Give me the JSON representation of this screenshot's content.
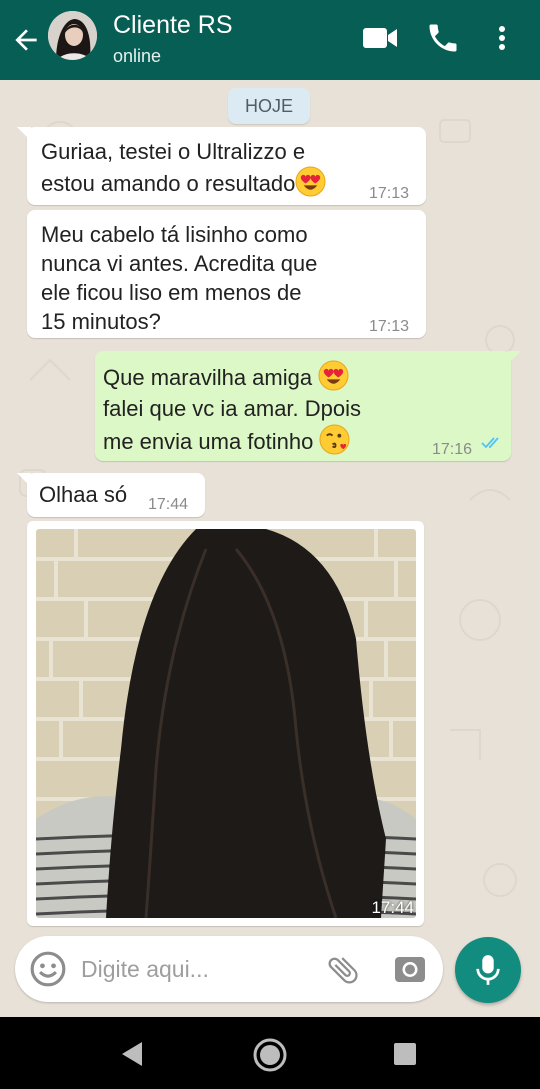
{
  "header": {
    "contact_name": "Cliente RS",
    "status": "online",
    "colors": {
      "bar": "#075e54",
      "accent": "#128c7e"
    },
    "icons": [
      "back-arrow-icon",
      "video-call-icon",
      "phone-icon",
      "more-vert-icon"
    ]
  },
  "chat": {
    "date_label": "HOJE",
    "messages": [
      {
        "direction": "in",
        "lines": [
          "Guriaa, testei o Ultralizzo e",
          "estou amando o resultado"
        ],
        "emoji": "heart-eyes",
        "time": "17:13"
      },
      {
        "direction": "in",
        "lines": [
          "Meu cabelo tá lisinho como",
          "nunca vi antes. Acredita que",
          "ele ficou liso em menos de",
          "15 minutos?"
        ],
        "time": "17:13"
      },
      {
        "direction": "out",
        "lines": [
          "Que maravilha amiga",
          "falei que vc ia amar. Dpois",
          "me envia uma fotinho"
        ],
        "emojis": [
          "heart-eyes",
          "kissing-heart"
        ],
        "time": "17:16",
        "status": "read"
      },
      {
        "direction": "in",
        "lines": [
          "Olhaa só"
        ],
        "time": "17:44"
      },
      {
        "direction": "in",
        "type": "image",
        "subject": "long straight dark hair, back view",
        "time": "17:44"
      }
    ]
  },
  "composer": {
    "placeholder": "Digite aqui..."
  },
  "navbar": {
    "icons": [
      "nav-back-icon",
      "nav-home-icon",
      "nav-recents-icon"
    ]
  }
}
